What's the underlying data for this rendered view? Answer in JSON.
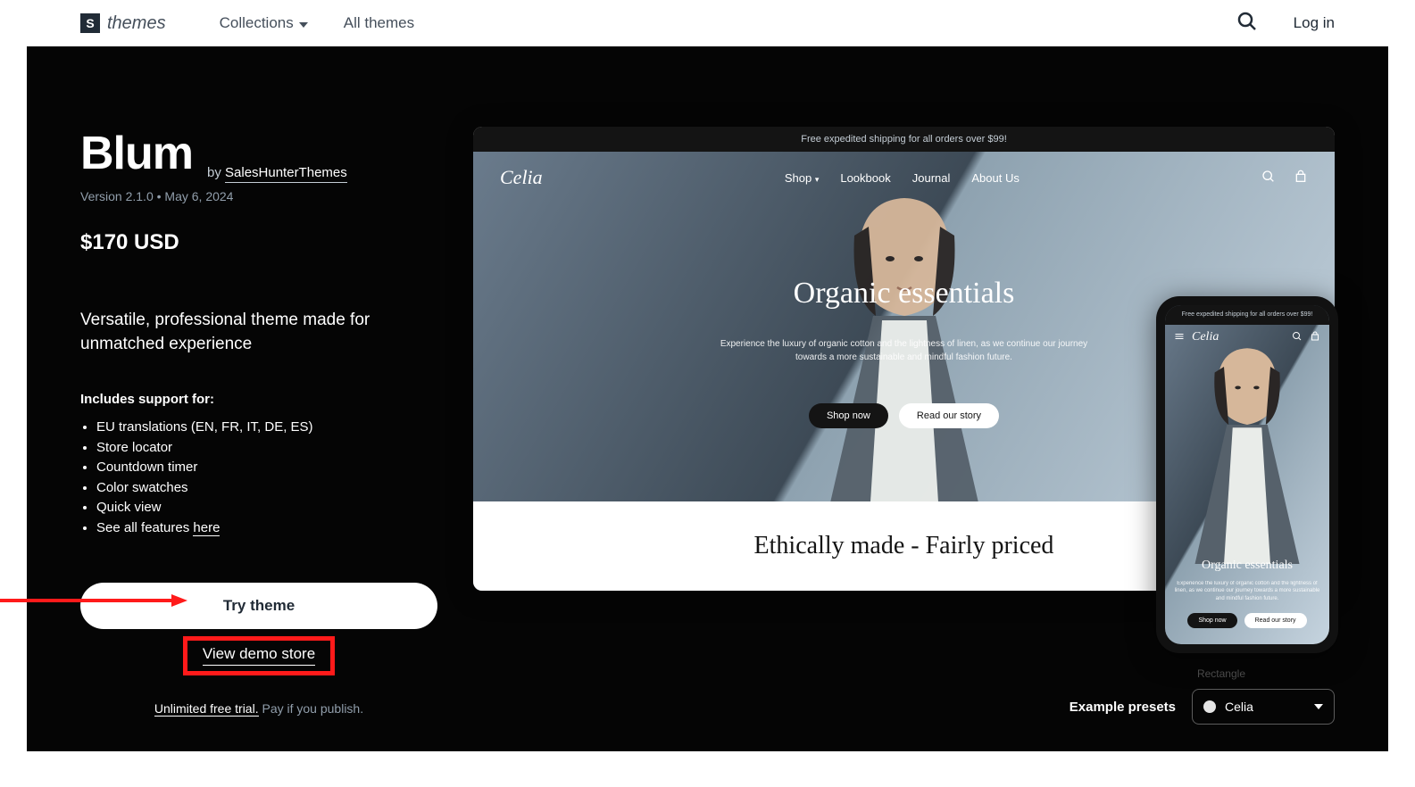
{
  "nav": {
    "brand": "themes",
    "collections": "Collections",
    "all_themes": "All themes",
    "login": "Log in"
  },
  "hero": {
    "title": "Blum",
    "by_prefix": "by ",
    "author": "SalesHunterThemes",
    "version_prefix": "Version ",
    "version": "2.1.0",
    "sep": " • ",
    "date": "May 6, 2024",
    "price": "$170 USD",
    "tagline": "Versatile, professional theme made for unmatched experience",
    "support_heading": "Includes support for:",
    "features": [
      "EU translations (EN, FR, IT, DE, ES)",
      "Store locator",
      "Countdown timer",
      "Color swatches",
      "Quick view"
    ],
    "see_all_prefix": "See all features ",
    "see_all_link": "here",
    "try_label": "Try theme",
    "demo_label": "View demo store",
    "trial_underlined": "Unlimited free trial.",
    "trial_rest": " Pay if you publish."
  },
  "preview": {
    "announce": "Free expedited shipping for all orders over $99!",
    "logo": "Celia",
    "nav": {
      "shop": "Shop",
      "lookbook": "Lookbook",
      "journal": "Journal",
      "about": "About Us"
    },
    "headline": "Organic essentials",
    "sub1": "Experience the luxury of organic cotton and the lightness of linen, as we continue our journey",
    "sub2": "towards a more sustainable and mindful fashion future.",
    "btn_shop": "Shop now",
    "btn_story": "Read our story",
    "foot": "Ethically made - Fairly priced"
  },
  "mobile": {
    "announce": "Free expedited shipping for all orders over $99!",
    "logo": "Celia",
    "headline": "Organic essentials",
    "sub": "Experience the luxury of organic cotton and the lightness of linen, as we continue our journey towards a more sustainable and mindful fashion future.",
    "btn_shop": "Shop now",
    "btn_story": "Read our story"
  },
  "presets": {
    "hint": "Rectangle",
    "label": "Example presets",
    "selected": "Celia"
  }
}
